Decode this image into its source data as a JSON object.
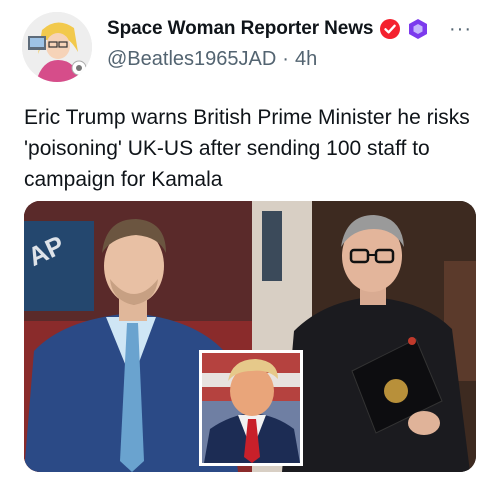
{
  "author": {
    "display_name": "Space Woman Reporter News",
    "handle": "@Beatles1965JAD",
    "separator": "·",
    "time_ago": "4h",
    "verified_badge_color": "#f4212e",
    "affiliate_badge_color": "#7c3aed"
  },
  "post": {
    "text": "Eric Trump warns British Prime Minister he risks 'poisoning' UK-US after sending 100 staff to campaign for Kamala"
  },
  "menu": {
    "more_label": "···"
  },
  "media": {
    "left_photo": "eric-trump-photo",
    "right_photo": "keir-starmer-photo",
    "inset_photo": "donald-trump-photo",
    "backdrop_text": "AP"
  }
}
